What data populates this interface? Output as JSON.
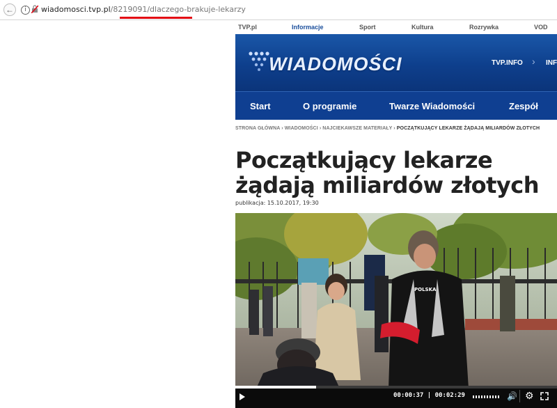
{
  "browser": {
    "url_host": "wiadomosci.tvp.pl",
    "url_path_id": "/8219091/",
    "url_slug": "dlaczego-brakuje-lekarzy"
  },
  "topnav": {
    "items": [
      "TVP.pl",
      "Informacje",
      "Sport",
      "Kultura",
      "Rozrywka",
      "VOD"
    ],
    "active": "Informacje",
    "active_color": "#1b4f9c"
  },
  "banner": {
    "logo_text": "WIADOMOŚCI",
    "tvp_info": "TVP.INFO",
    "tvp_info_partial": "INF",
    "bg_color": "#0e3f8c"
  },
  "mainnav": {
    "items": [
      "Start",
      "O programie",
      "Twarze Wiadomości",
      "Zespół"
    ]
  },
  "breadcrumb": {
    "items": [
      "STRONA GŁÓWNA",
      "WIADOMOŚCI",
      "NAJCIEKAWSZE MATERIAŁY"
    ],
    "current": "POCZĄTKUJĄCY LEKARZE ŻĄDAJĄ MILIARDÓW ZŁOTYCH",
    "separator": "›"
  },
  "article": {
    "title": "Początkujący lekarze żądają miliardów złotych",
    "published": "publikacja: 15.10.2017, 19:30"
  },
  "player": {
    "time_current": "00:00:37",
    "time_total": "00:02:29",
    "time_separator": " | ",
    "progress_fraction": 0.25,
    "vest_text": "POLSKA"
  }
}
